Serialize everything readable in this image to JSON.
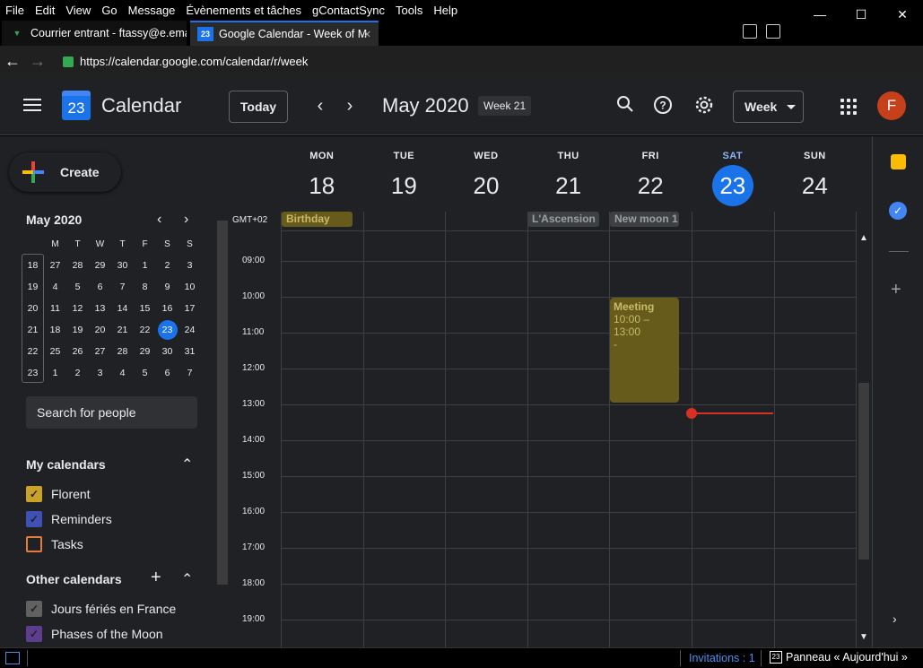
{
  "menubar": {
    "items": [
      "File",
      "Edit",
      "View",
      "Go",
      "Message",
      "Évènements et tâches",
      "gContactSync",
      "Tools",
      "Help"
    ]
  },
  "tabs": [
    {
      "label": "Courrier entrant - ftassy@e.ema",
      "icon": "inbox-icon"
    },
    {
      "label": "Google Calendar - Week of M",
      "icon": "calendar-icon",
      "icon_text": "23"
    }
  ],
  "address": {
    "url": "https://calendar.google.com/calendar/r/week"
  },
  "header": {
    "app_title": "Calendar",
    "logo_day": "23",
    "today_label": "Today",
    "month_label": "May 2020",
    "week_chip": "Week 21",
    "view_label": "Week",
    "avatar_letter": "F"
  },
  "sidebar": {
    "create_label": "Create",
    "mini_month": "May 2020",
    "weekday_initials": [
      "M",
      "T",
      "W",
      "T",
      "F",
      "S",
      "S"
    ],
    "weeks": [
      {
        "num": "18",
        "days": [
          "27",
          "28",
          "29",
          "30",
          "1",
          "2",
          "3"
        ]
      },
      {
        "num": "19",
        "days": [
          "4",
          "5",
          "6",
          "7",
          "8",
          "9",
          "10"
        ]
      },
      {
        "num": "20",
        "days": [
          "11",
          "12",
          "13",
          "14",
          "15",
          "16",
          "17"
        ]
      },
      {
        "num": "21",
        "days": [
          "18",
          "19",
          "20",
          "21",
          "22",
          "23",
          "24"
        ]
      },
      {
        "num": "22",
        "days": [
          "25",
          "26",
          "27",
          "28",
          "29",
          "30",
          "31"
        ]
      },
      {
        "num": "23",
        "days": [
          "1",
          "2",
          "3",
          "4",
          "5",
          "6",
          "7"
        ]
      }
    ],
    "today_day": "23",
    "search_placeholder": "Search for people",
    "my_calendars_title": "My calendars",
    "my_calendars": [
      {
        "label": "Florent",
        "color": "#c9a227",
        "checked": true
      },
      {
        "label": "Reminders",
        "color": "#3f51b5",
        "checked": true
      },
      {
        "label": "Tasks",
        "color": "#e67c3b",
        "checked": false
      }
    ],
    "other_calendars_title": "Other calendars",
    "other_calendars": [
      {
        "label": "Jours fériés en France",
        "color": "#616161",
        "checked": true
      },
      {
        "label": "Phases of the Moon",
        "color": "#5e3d8f",
        "checked": true
      }
    ]
  },
  "week": {
    "timezone": "GMT+02",
    "days": [
      {
        "dow": "MON",
        "num": "18"
      },
      {
        "dow": "TUE",
        "num": "19"
      },
      {
        "dow": "WED",
        "num": "20"
      },
      {
        "dow": "THU",
        "num": "21"
      },
      {
        "dow": "FRI",
        "num": "22"
      },
      {
        "dow": "SAT",
        "num": "23",
        "current": true
      },
      {
        "dow": "SUN",
        "num": "24"
      }
    ],
    "hours": [
      "09:00",
      "10:00",
      "11:00",
      "12:00",
      "13:00",
      "14:00",
      "15:00",
      "16:00",
      "17:00",
      "18:00",
      "19:00"
    ],
    "allday_events": [
      {
        "label": "Birthday",
        "day": "MON",
        "color": "#665b1a",
        "text_color": "#c9b96a"
      },
      {
        "label": "L'Ascension",
        "day": "THU",
        "color": "#3c4043",
        "text_color": "#9aa0a6"
      },
      {
        "label": "New moon 1",
        "day": "FRI",
        "color": "#3c4043",
        "text_color": "#9aa0a6"
      }
    ],
    "timed_events": [
      {
        "title": "Meeting",
        "time": "10:00 – 13:00",
        "extra": "-",
        "day": "FRI",
        "color": "#665b1a"
      }
    ]
  },
  "statusbar": {
    "invitations": "Invitations : 1",
    "today_pane": "Panneau « Aujourd'hui »",
    "today_pane_icon_text": "23"
  },
  "colors": {
    "accent": "#1a73e8",
    "now_line": "#d93025",
    "background": "#202124"
  }
}
